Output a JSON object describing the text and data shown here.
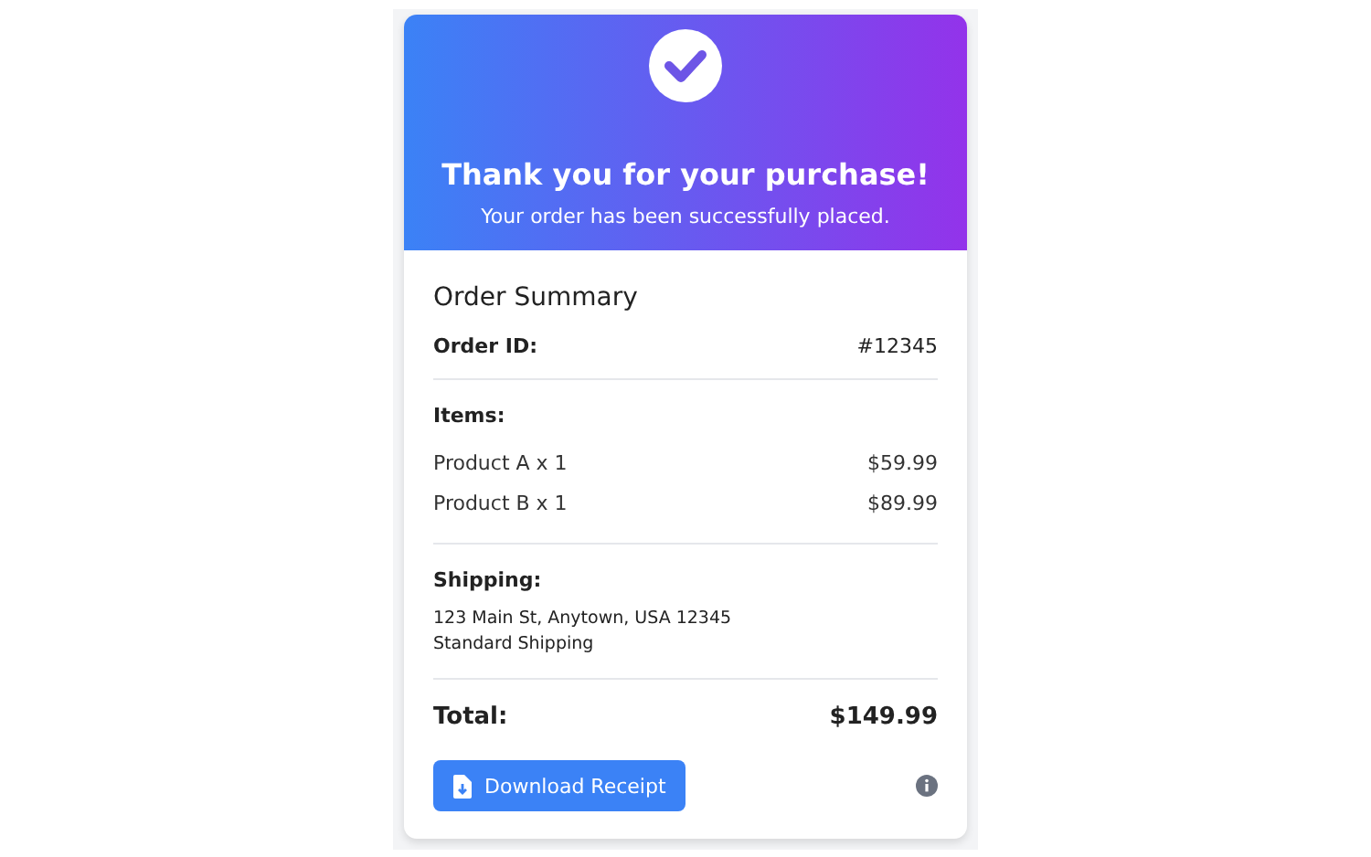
{
  "header": {
    "title": "Thank you for your purchase!",
    "subtitle": "Your order has been successfully placed."
  },
  "summary": {
    "heading": "Order Summary",
    "order_id_label": "Order ID:",
    "order_id": "#12345",
    "items_label": "Items:",
    "items": [
      {
        "name": "Product A x 1",
        "price": "$59.99"
      },
      {
        "name": "Product B x 1",
        "price": "$89.99"
      }
    ],
    "shipping_label": "Shipping:",
    "shipping_lines": [
      "123 Main St, Anytown, USA 12345",
      "Standard Shipping"
    ],
    "total_label": "Total:",
    "total": "$149.99"
  },
  "download_button": "Download Receipt"
}
